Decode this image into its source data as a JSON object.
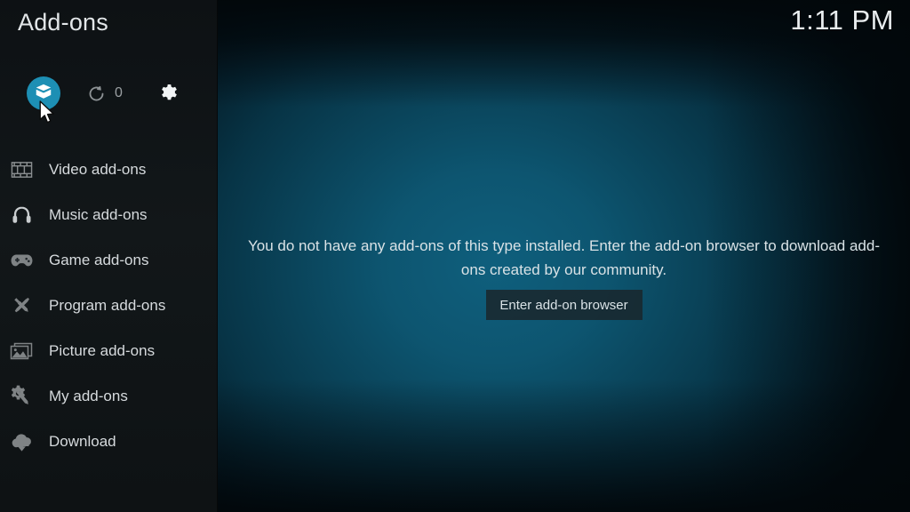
{
  "header": {
    "title": "Add-ons",
    "clock": "1:11 PM"
  },
  "toolbar": {
    "items": [
      {
        "name": "addon-browser",
        "icon": "box-icon",
        "label": "",
        "selected": true
      },
      {
        "name": "check-updates",
        "icon": "refresh-icon",
        "label": "0",
        "selected": false
      },
      {
        "name": "settings",
        "icon": "gear-icon",
        "label": "",
        "selected": false
      }
    ],
    "update_count": "0"
  },
  "sidebar": {
    "items": [
      {
        "label": "Video add-ons",
        "icon": "film-icon"
      },
      {
        "label": "Music add-ons",
        "icon": "headphones-icon"
      },
      {
        "label": "Game add-ons",
        "icon": "gamepad-icon"
      },
      {
        "label": "Program add-ons",
        "icon": "tools-icon"
      },
      {
        "label": "Picture add-ons",
        "icon": "image-icon"
      },
      {
        "label": "My add-ons",
        "icon": "gear-wrench-icon"
      },
      {
        "label": "Download",
        "icon": "cloud-download-icon"
      }
    ]
  },
  "main": {
    "empty_message": "You do not have any add-ons of this type installed. Enter the add-on browser to download add-ons created by our community.",
    "button_label": "Enter add-on browser"
  },
  "colors": {
    "accent": "#1d8fb4",
    "sidebar_bg": "#121719",
    "background_teal": "#0f5f7d",
    "text_primary": "#d9e2e6",
    "text_muted": "#9ba0a3"
  }
}
